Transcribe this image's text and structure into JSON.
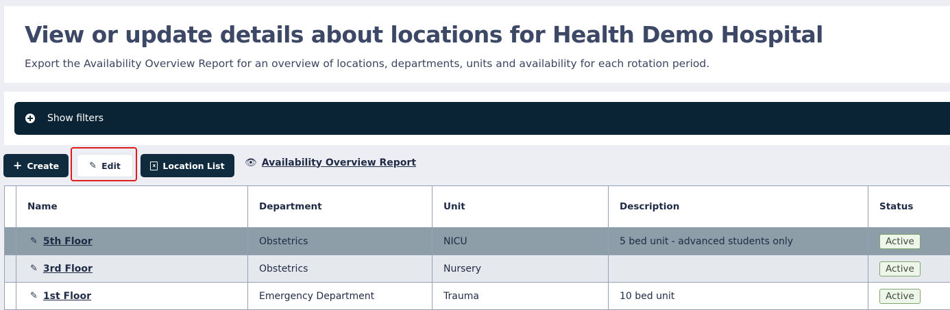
{
  "header": {
    "title": "View or update details about locations for Health Demo Hospital",
    "subtitle": "Export the Availability Overview Report for an overview of locations, departments, units and availability for each rotation period."
  },
  "filters": {
    "toggle_label": "Show filters"
  },
  "toolbar": {
    "create_label": "Create",
    "edit_label": "Edit",
    "location_list_label": "Location List",
    "report_link_label": "Availability Overview Report"
  },
  "table": {
    "columns": [
      "Name",
      "Department",
      "Unit",
      "Description",
      "Status"
    ],
    "rows": [
      {
        "name": "5th Floor",
        "department": "Obstetrics",
        "unit": "NICU",
        "description": "5 bed unit - advanced students only",
        "status": "Active"
      },
      {
        "name": "3rd Floor",
        "department": "Obstetrics",
        "unit": "Nursery",
        "description": "",
        "status": "Active"
      },
      {
        "name": "1st Floor",
        "department": "Emergency Department",
        "unit": "Trauma",
        "description": "10 bed unit",
        "status": "Active"
      }
    ]
  },
  "colors": {
    "navy": "#0a2436",
    "highlight": "#e01b1b",
    "selected_row": "#8d9ea8",
    "status_border": "#7ea36f"
  }
}
